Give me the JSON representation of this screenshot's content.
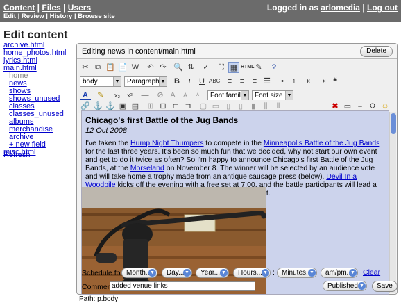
{
  "nav": {
    "primary": [
      "Content",
      "Files",
      "Users"
    ],
    "secondary": [
      "Edit",
      "Review",
      "History",
      "Browse site"
    ],
    "logged_in_as": "Logged in as",
    "username": "arlomedia",
    "logout": "Log out"
  },
  "page_title": "Edit content",
  "tree": [
    {
      "label": "archive.html",
      "level": 0
    },
    {
      "label": "home_photos.html",
      "level": 0
    },
    {
      "label": "lyrics.html",
      "level": 0
    },
    {
      "label": "main.html",
      "level": 0
    },
    {
      "label": "home",
      "level": 1,
      "current": true
    },
    {
      "label": "news",
      "level": 1
    },
    {
      "label": "shows",
      "level": 1
    },
    {
      "label": "shows_unused",
      "level": 1
    },
    {
      "label": "classes",
      "level": 1
    },
    {
      "label": "classes_unused",
      "level": 1
    },
    {
      "label": "albums",
      "level": 1
    },
    {
      "label": "merchandise",
      "level": 1
    },
    {
      "label": "archive",
      "level": 1
    },
    {
      "label": "+ new field",
      "level": 1
    },
    {
      "label": "misc.html",
      "level": 0
    }
  ],
  "refresh": "Refresh",
  "editor": {
    "title": "Editing news in content/main.html",
    "delete": "Delete",
    "style_select": "body",
    "format_select": "Paragraph",
    "font_family": "Font family",
    "font_size": "Font size",
    "path": "Path: p.body"
  },
  "article": {
    "heading": "Chicago's first Battle of the Jug Bands",
    "date": "12 Oct 2008",
    "p1": "I've taken the ",
    "link1": "Hump Night Thumpers",
    "p2": " to compete in the ",
    "link2": "Minneapolis Battle of the Jug Bands",
    "p3": " for the last three years. It's been so much fun that we decided, why not start our own event and get to do it twice as often? So I'm happy to announce Chicago's first Battle of the Jug Bands, at the ",
    "link3": "Morseland",
    "p4": " on November 8. The winner will be selected by an audience vote and will take home a trophy made from an antique sausage press (below). ",
    "link4": "Devil In a Woodpile",
    "p5": " kicks off the evening with a free set at 7:00, and the battle participants will lead a public jam session after the Battle ends, around midnight."
  },
  "schedule": {
    "label": "Schedule for:",
    "month": "Month...",
    "day": "Day...",
    "year": "Year...",
    "hours": "Hours...",
    "colon": ":",
    "minutes": "Minutes...",
    "ampm": "am/pm...",
    "clear": "Clear",
    "comment_label": "Comment:",
    "comment_value": "added venue links",
    "status": "Published",
    "save": "Save"
  },
  "icons": [
    "cut-icon",
    "copy-icon",
    "paste-icon",
    "undo-icon",
    "redo-icon",
    "find-icon",
    "bold-icon",
    "italic-icon",
    "underline-icon",
    "strike-icon",
    "align-left-icon",
    "align-center-icon",
    "align-right-icon",
    "justify-icon",
    "bullet-list-icon",
    "numbered-list-icon",
    "outdent-icon",
    "indent-icon",
    "blockquote-icon",
    "text-color-icon",
    "highlight-icon",
    "subscript-icon",
    "superscript-icon",
    "image-icon",
    "table-icon",
    "omega-icon",
    "smiley-icon",
    "help-icon",
    "html-icon"
  ]
}
